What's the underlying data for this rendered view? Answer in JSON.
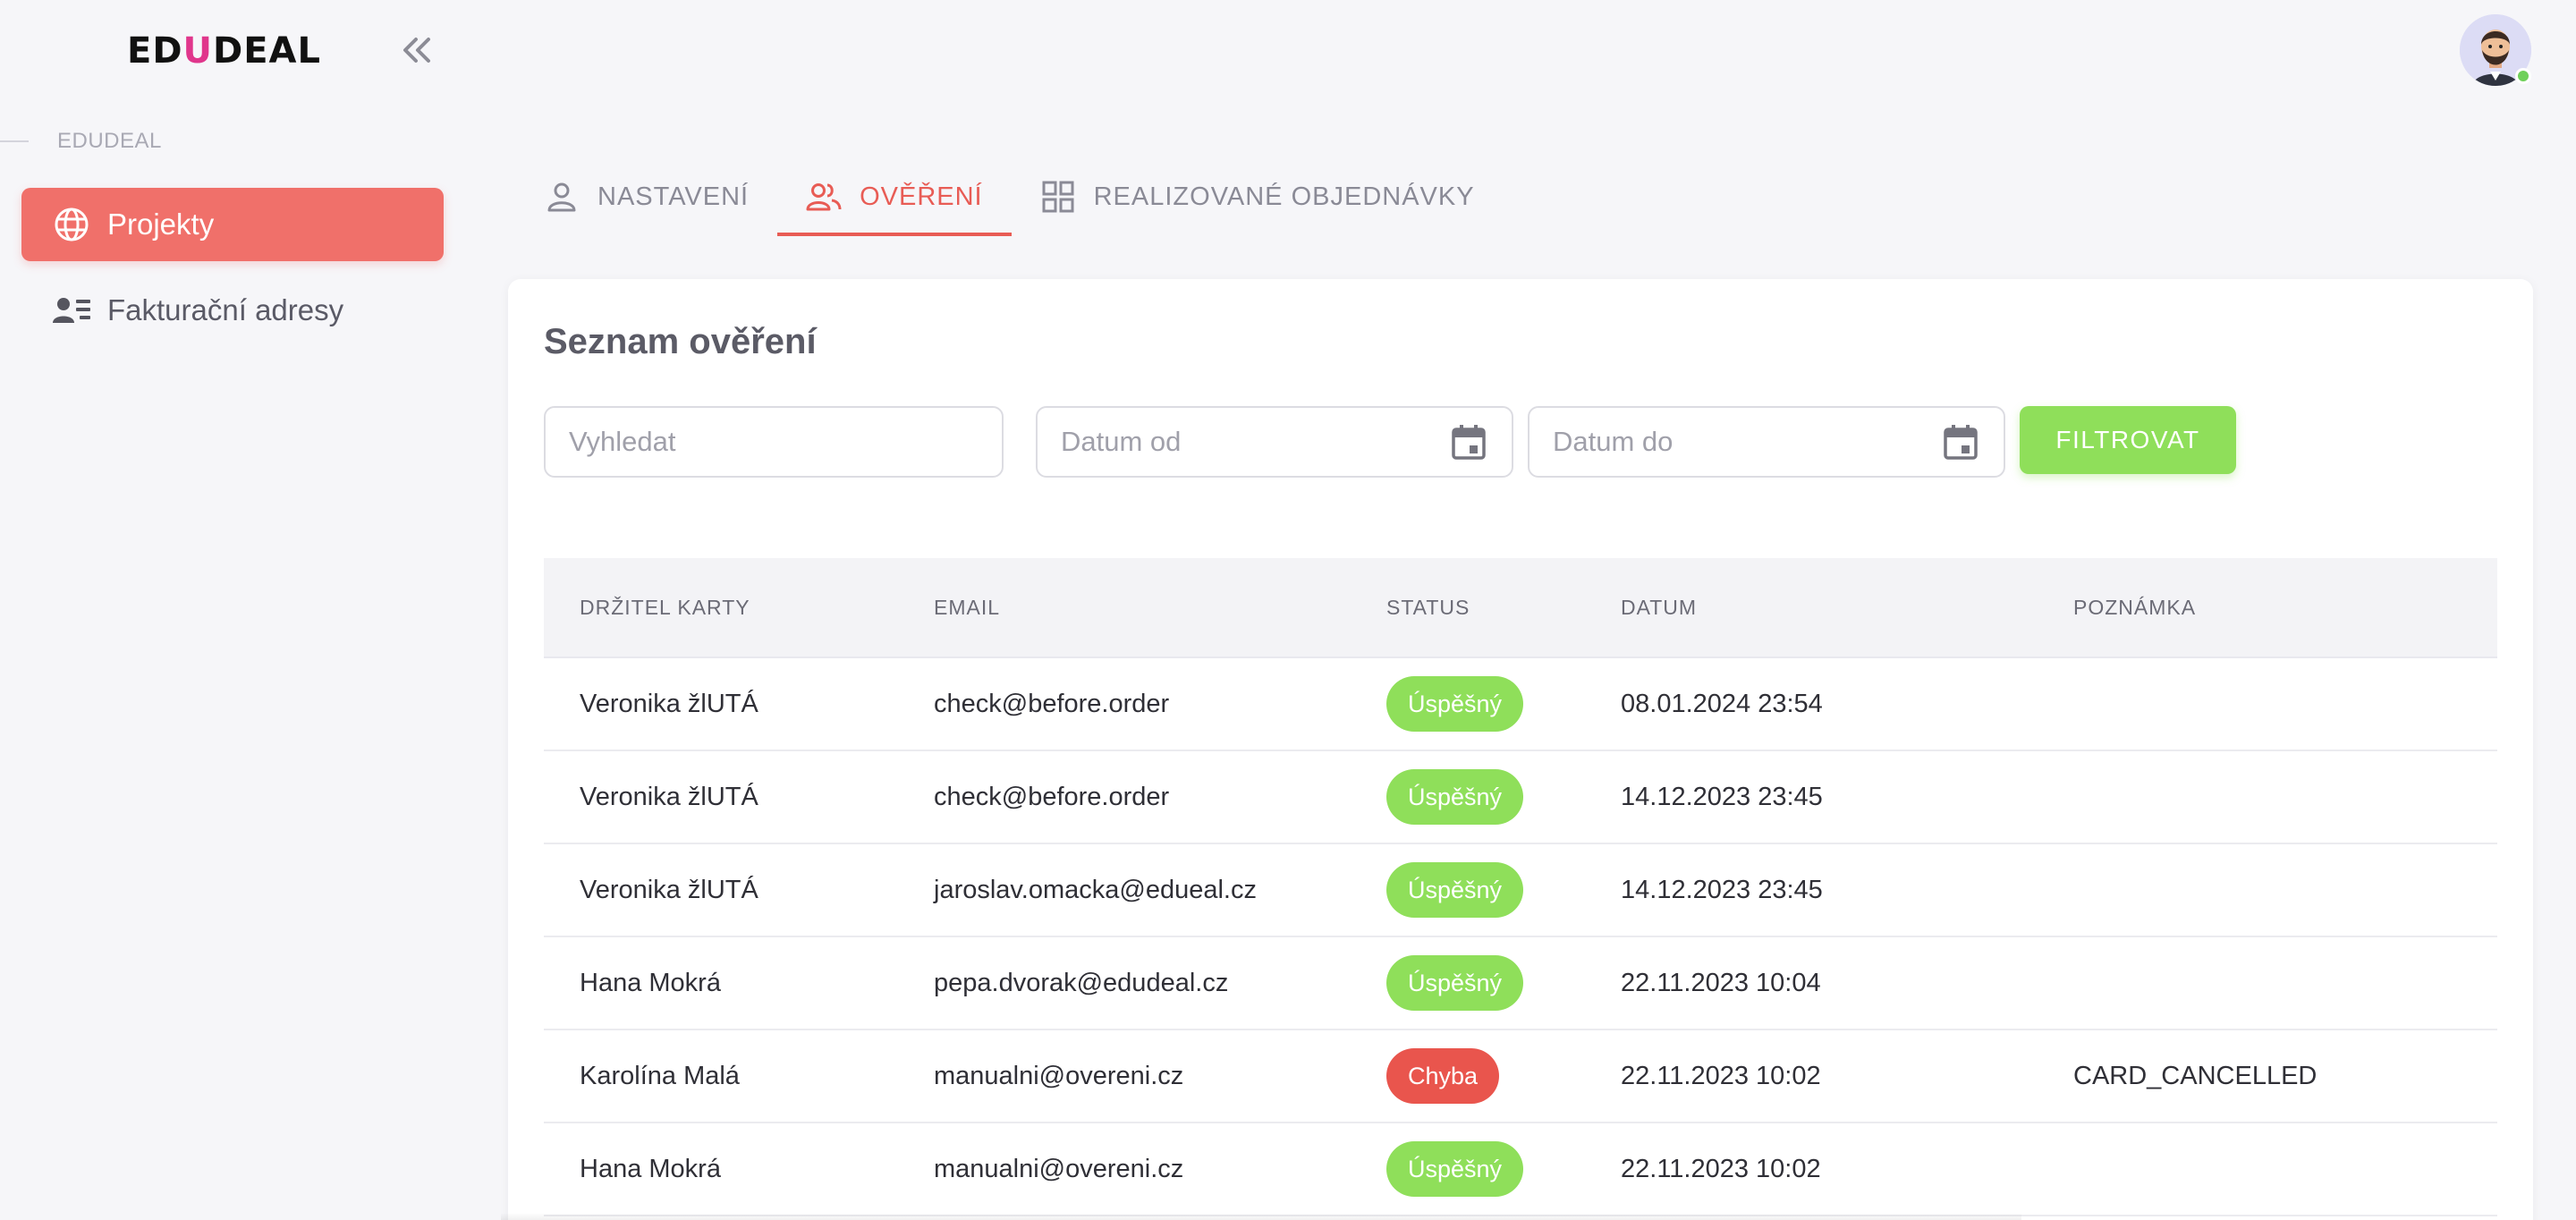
{
  "brand": {
    "logo_prefix": "ED",
    "logo_u": "U",
    "logo_suffix": "DEAL"
  },
  "sidebar": {
    "section_label": "EDUDEAL",
    "items": [
      {
        "label": "Projekty",
        "icon": "globe-icon",
        "active": true
      },
      {
        "label": "Fakturační adresy",
        "icon": "contact-list-icon",
        "active": false
      }
    ]
  },
  "tabs": [
    {
      "label": "NASTAVENÍ",
      "icon": "person-icon",
      "active": false
    },
    {
      "label": "OVĚŘENÍ",
      "icon": "people-icon",
      "active": true
    },
    {
      "label": "REALIZOVANÉ OBJEDNÁVKY",
      "icon": "grid-icon",
      "active": false
    }
  ],
  "card": {
    "title": "Seznam ověření",
    "search_placeholder": "Vyhledat",
    "date_from_placeholder": "Datum od",
    "date_to_placeholder": "Datum do",
    "filter_label": "FILTROVAT"
  },
  "table": {
    "headers": [
      "DRŽITEL KARTY",
      "EMAIL",
      "STATUS",
      "DATUM",
      "POZNÁMKA"
    ],
    "rows": [
      {
        "holder": "Veronika žlUTÁ",
        "email": "check@before.order",
        "status": "Úspěšný",
        "status_type": "ok",
        "date": "08.01.2024 23:54",
        "note": ""
      },
      {
        "holder": "Veronika žlUTÁ",
        "email": "check@before.order",
        "status": "Úspěšný",
        "status_type": "ok",
        "date": "14.12.2023 23:45",
        "note": ""
      },
      {
        "holder": "Veronika žlUTÁ",
        "email": "jaroslav.omacka@edueal.cz",
        "status": "Úspěšný",
        "status_type": "ok",
        "date": "14.12.2023 23:45",
        "note": ""
      },
      {
        "holder": "Hana Mokrá",
        "email": "pepa.dvorak@edudeal.cz",
        "status": "Úspěšný",
        "status_type": "ok",
        "date": "22.11.2023 10:04",
        "note": ""
      },
      {
        "holder": "Karolína Malá",
        "email": "manualni@overeni.cz",
        "status": "Chyba",
        "status_type": "err",
        "date": "22.11.2023 10:02",
        "note": "CARD_CANCELLED"
      },
      {
        "holder": "Hana Mokrá",
        "email": "manualni@overeni.cz",
        "status": "Úspěšný",
        "status_type": "ok",
        "date": "22.11.2023 10:02",
        "note": ""
      }
    ]
  },
  "colors": {
    "accent": "#f0706a",
    "tab_active": "#e85c55",
    "success": "#8fdf5a",
    "error": "#e9554d"
  }
}
